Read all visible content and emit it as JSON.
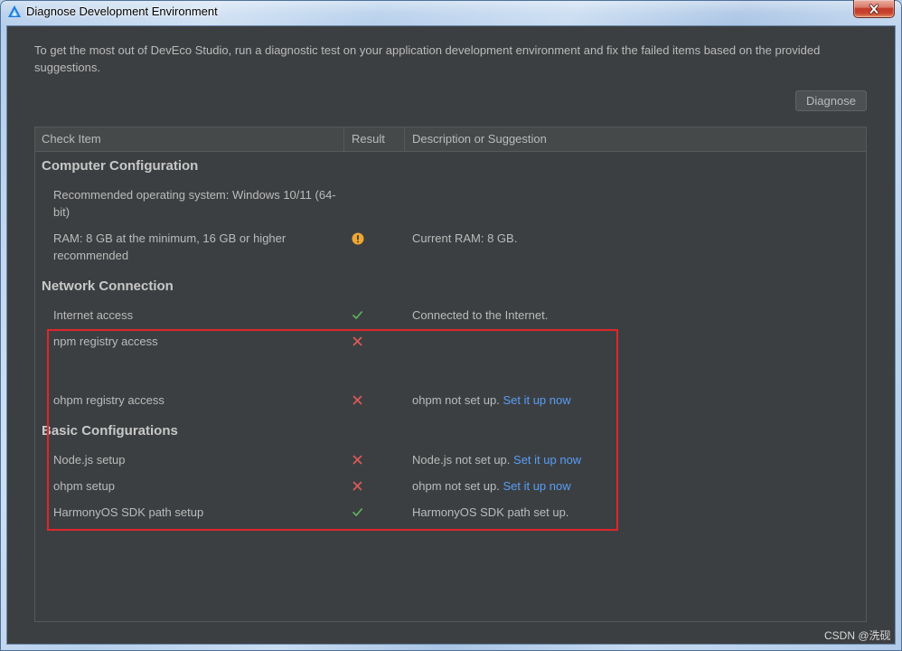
{
  "window": {
    "title": "Diagnose Development Environment",
    "icon": "deveco-studio-icon",
    "close_icon": "close-icon"
  },
  "intro": "To get the most out of DevEco Studio, run a diagnostic test on your application development environment and fix the failed items based on the provided suggestions.",
  "toolbar": {
    "diagnose_label": "Diagnose"
  },
  "table": {
    "columns": {
      "check_item": "Check Item",
      "result": "Result",
      "description": "Description or Suggestion"
    },
    "sections": [
      {
        "title": "Computer Configuration",
        "rows": [
          {
            "item": "Recommended operating system: Windows 10/11 (64-bit)"
          },
          {
            "item": "RAM: 8 GB at the minimum, 16 GB or higher recommended",
            "result_icon": "warning-icon",
            "description": "Current RAM: 8 GB."
          }
        ]
      },
      {
        "title": "Network Connection",
        "rows": [
          {
            "item": "Internet access",
            "result_icon": "check-icon",
            "description": "Connected to the Internet."
          },
          {
            "item": "npm registry access",
            "result_icon": "error-icon"
          },
          {
            "item": "ohpm registry access",
            "result_icon": "error-icon",
            "description": "ohpm not set up.",
            "link": "Set it up now"
          }
        ]
      },
      {
        "title": "Basic Configurations",
        "rows": [
          {
            "item": "Node.js setup",
            "result_icon": "error-icon",
            "description": "Node.js not set up.",
            "link": "Set it up now"
          },
          {
            "item": "ohpm setup",
            "result_icon": "error-icon",
            "description": "ohpm not set up.",
            "link": "Set it up now"
          },
          {
            "item": "HarmonyOS SDK path setup",
            "result_icon": "check-icon",
            "description": "HarmonyOS SDK path set up."
          }
        ]
      }
    ]
  },
  "watermark": "CSDN @洗砚",
  "colors": {
    "background": "#3c3f41",
    "header_bg": "#45494a",
    "border": "#55595b",
    "text": "#bbbbbb",
    "section_text": "#c8c8c8",
    "link": "#589df6",
    "pass": "#5fb35f",
    "fail": "#de5a5a",
    "warning": "#f0a732",
    "annotation": "#e0262b",
    "button_bg": "#4c5052"
  }
}
